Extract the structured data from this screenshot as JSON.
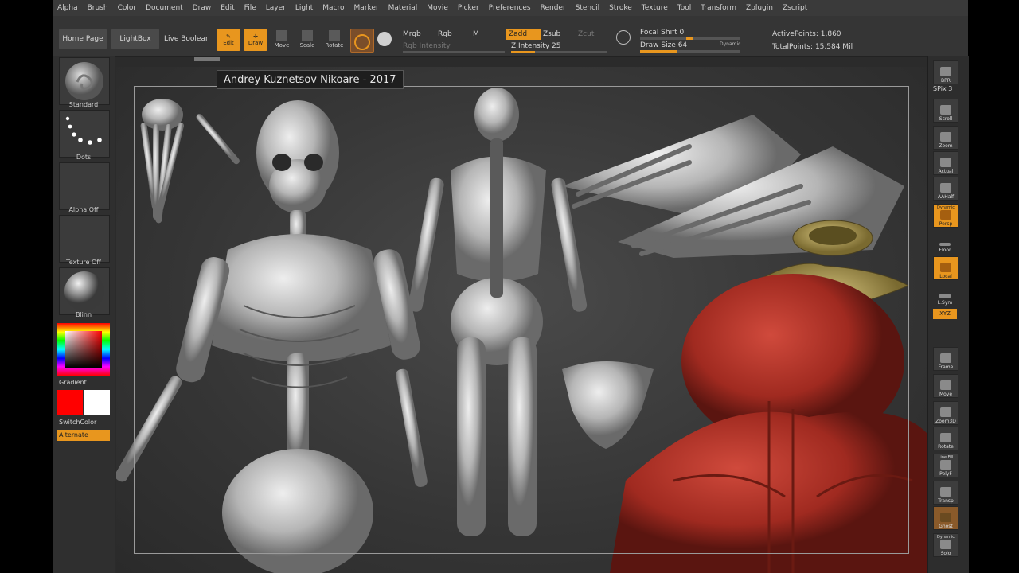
{
  "menu": [
    "Alpha",
    "Brush",
    "Color",
    "Document",
    "Draw",
    "Edit",
    "File",
    "Layer",
    "Light",
    "Macro",
    "Marker",
    "Material",
    "Movie",
    "Picker",
    "Preferences",
    "Render",
    "Stencil",
    "Stroke",
    "Texture",
    "Tool",
    "Transform",
    "Zplugin",
    "Zscript"
  ],
  "toolbar": {
    "home_page": "Home Page",
    "lightbox": "LightBox",
    "live_boolean": "Live Boolean",
    "edit": "Edit",
    "draw": "Draw",
    "move": "Move",
    "scale": "Scale",
    "rotate": "Rotate",
    "mrgb": "Mrgb",
    "rgb": "Rgb",
    "m": "M",
    "zadd": "Zadd",
    "zsub": "Zsub",
    "zcut": "Zcut",
    "rgb_intensity": "Rgb Intensity",
    "z_intensity": "Z Intensity 25",
    "focal_shift": "Focal Shift 0",
    "draw_size": "Draw Size 64",
    "dynamic": "Dynamic",
    "active_points": "ActivePoints: 1,860",
    "total_points": "TotalPoints: 15.584 Mil"
  },
  "left_tray": {
    "brush": "Standard",
    "stroke": "Dots",
    "alpha": "Alpha Off",
    "texture": "Texture Off",
    "material": "Blinn",
    "gradient": "Gradient",
    "switch_color": "SwitchColor",
    "alternate": "Alternate",
    "main_color": "#ff0000",
    "secondary_color": "#ffffff"
  },
  "right_tray": {
    "bpr": "BPR",
    "spix": "SPix 3",
    "scroll": "Scroll",
    "zoom": "Zoom",
    "actual": "Actual",
    "aahalf": "AAHalf",
    "dynamic": "Dynamic",
    "persp": "Persp",
    "floor": "Floor",
    "local": "Local",
    "lsym": "L.Sym",
    "xyz": "XYZ",
    "frame": "Frame",
    "move": "Move",
    "zoom3d": "Zoom3D",
    "rotate": "Rotate",
    "line_fill": "Line Fill",
    "polyf": "PolyF",
    "transp": "Transp",
    "ghost": "Ghost",
    "solo": "Solo",
    "dynamic2": "Dynamic"
  },
  "canvas": {
    "credit": "Andrey Kuznetsov Nikoare - 2017"
  },
  "colors": {
    "accent": "#e8961e",
    "bone": "#c8c8c8",
    "muscle_red": "#a02a20",
    "vertebra_olive": "#b7a45a"
  }
}
